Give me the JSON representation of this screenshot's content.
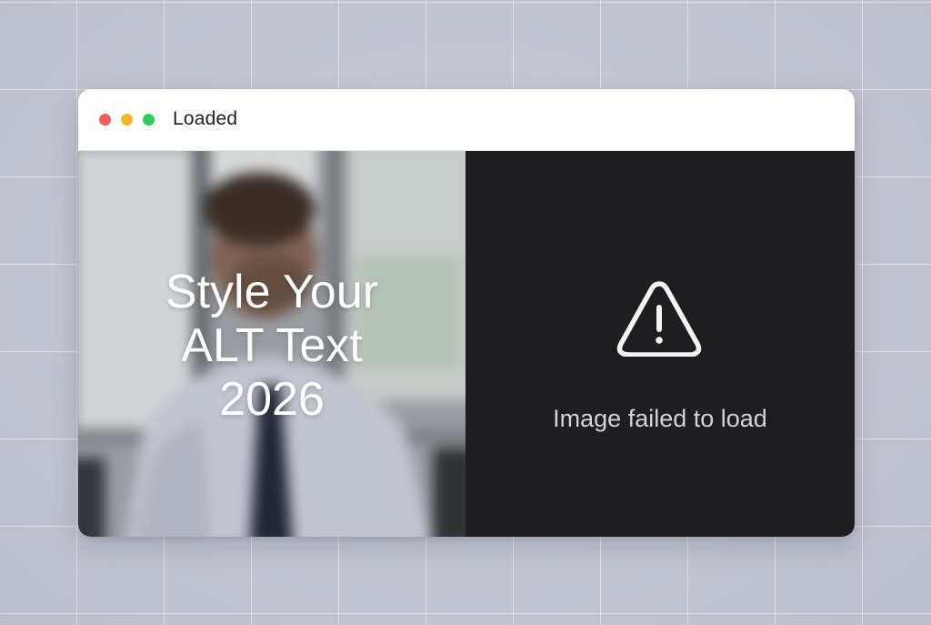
{
  "window": {
    "title": "Loaded",
    "controls": {
      "close_color": "#f25a5a",
      "minimize_color": "#f3b722",
      "maximize_color": "#2fce5b"
    }
  },
  "loaded_pane": {
    "image": "blurred-photo-man-in-shirt-and-tie",
    "alt_text_lines": [
      "Style Your",
      "ALT Text",
      "2026"
    ]
  },
  "failed_pane": {
    "icon": "warning-icon",
    "message": "Image failed to load",
    "background_color": "#1e1e21"
  }
}
